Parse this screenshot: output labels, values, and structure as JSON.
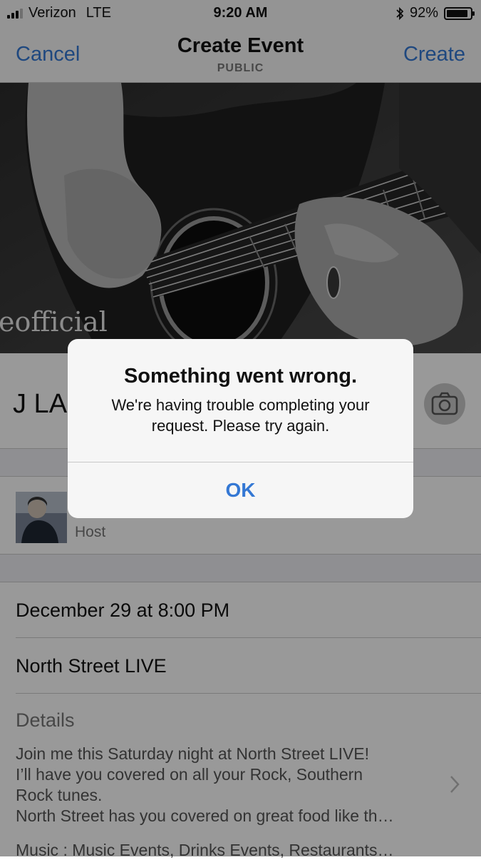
{
  "status_bar": {
    "carrier": "Verizon",
    "network": "LTE",
    "time": "9:20 AM",
    "battery_percent": "92%",
    "battery_level": 0.92,
    "icons": [
      "signal-icon",
      "bluetooth-icon",
      "battery-icon"
    ]
  },
  "nav": {
    "cancel_label": "Cancel",
    "title": "Create Event",
    "subtitle": "PUBLIC",
    "create_label": "Create"
  },
  "cover": {
    "watermark_text": "eofficial"
  },
  "event": {
    "name_partial": "J LA",
    "host_label": "Host",
    "date_time": "December 29 at 8:00 PM",
    "location": "North Street LIVE",
    "details_label": "Details",
    "details_lines": [
      "Join me this Saturday night at North Street LIVE!",
      "I’ll have you covered on all your Rock, Southern",
      "Rock tunes.",
      "North Street has you covered on great food like th…"
    ],
    "tags_line": "Music : Music Events, Drinks Events, Restaurants…"
  },
  "alert": {
    "title": "Something went wrong.",
    "message": "We're having trouble completing your request. Please try again.",
    "ok_label": "OK"
  },
  "colors": {
    "accent": "#3478d4",
    "overlay": "rgba(0,0,0,0.40)"
  }
}
